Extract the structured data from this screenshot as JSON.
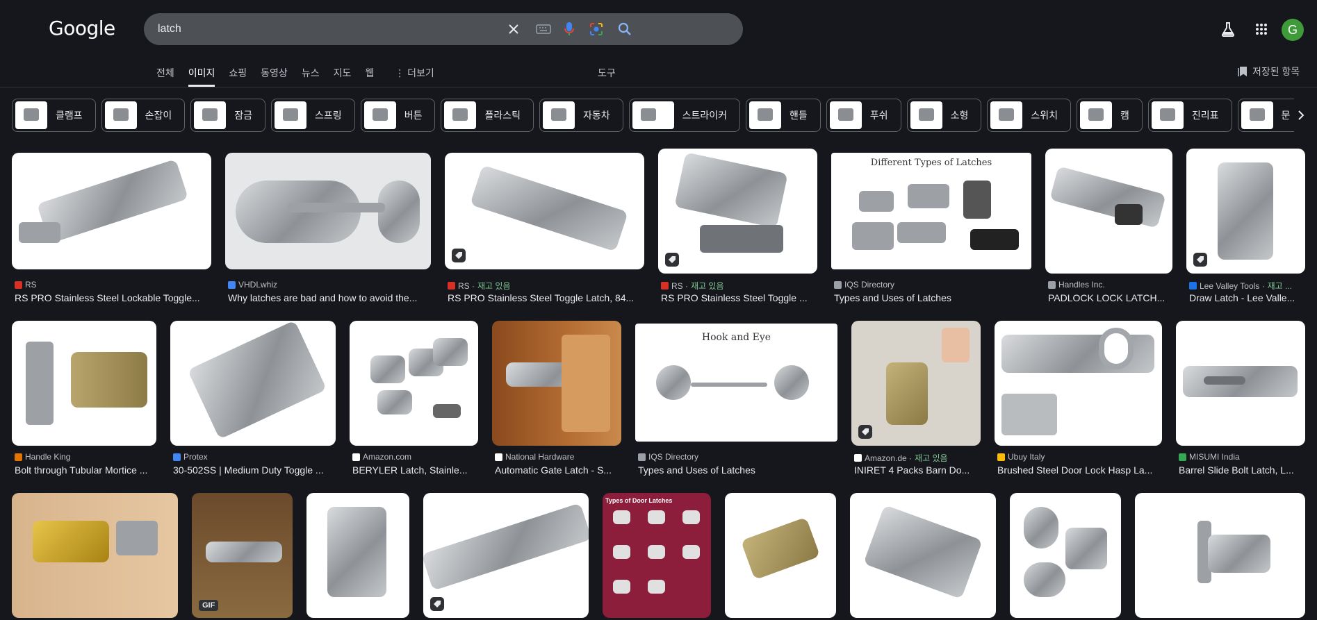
{
  "header": {
    "logo": "Google",
    "query": "latch",
    "avatar_letter": "G"
  },
  "tabs": [
    "전체",
    "이미지",
    "쇼핑",
    "동영상",
    "뉴스",
    "지도",
    "웹",
    "⋮ 더보기"
  ],
  "tools_label": "도구",
  "saved_label": "저장된 항목",
  "chips": [
    "클램프",
    "손잡이",
    "잠금",
    "스프링",
    "버튼",
    "플라스틱",
    "자동차",
    "스트라이커",
    "핸들",
    "푸쉬",
    "소형",
    "스위치",
    "캠",
    "진리표",
    "문"
  ],
  "stock_label": "재고 있음",
  "row1": [
    {
      "source": "RS",
      "title": "RS PRO Stainless Steel Lockable Toggle...",
      "fav": "#d93025"
    },
    {
      "source": "VHDLwhiz",
      "title": "Why latches are bad and how to avoid the...",
      "fav": "#4285f4"
    },
    {
      "source": "RS · ",
      "stock": "재고 있음",
      "title": "RS PRO Stainless Steel Toggle Latch, 84...",
      "fav": "#d93025"
    },
    {
      "source": "RS · ",
      "stock": "재고 있음",
      "title": "RS PRO Stainless Steel Toggle ...",
      "fav": "#d93025"
    },
    {
      "source": "IQS Directory",
      "title": "Types and Uses of Latches",
      "fav": "#9aa0a6",
      "overlay": "Different Types of Latches"
    },
    {
      "source": "Handles Inc.",
      "title": "PADLOCK LOCK LATCH...",
      "fav": "#9aa0a6"
    },
    {
      "source": "Lee Valley Tools · ",
      "stock": "재고 ...",
      "title": "Draw Latch - Lee Valle...",
      "fav": "#1a73e8"
    }
  ],
  "row2": [
    {
      "source": "Handle King",
      "title": "Bolt through Tubular Mortice ...",
      "fav": "#e37400"
    },
    {
      "source": "Protex",
      "title": "30-502SS | Medium Duty Toggle ...",
      "fav": "#4285f4"
    },
    {
      "source": "Amazon.com",
      "title": "BERYLER Latch, Stainle...",
      "fav": "#ffffff"
    },
    {
      "source": "National Hardware",
      "title": "Automatic Gate Latch - S...",
      "fav": "#ffffff"
    },
    {
      "source": "IQS Directory",
      "title": "Types and Uses of Latches",
      "fav": "#9aa0a6",
      "overlay": "Hook and Eye"
    },
    {
      "source": "Amazon.de · ",
      "stock": "재고 있음",
      "title": "INIRET 4 Packs Barn Do...",
      "fav": "#ffffff"
    },
    {
      "source": "Ubuy Italy",
      "title": "Brushed Steel Door Lock Hasp La...",
      "fav": "#fbbc04"
    },
    {
      "source": "MISUMI India",
      "title": "Barrel Slide Bolt Latch, L...",
      "fav": "#34a853"
    }
  ],
  "row3_overlays": {
    "gif": "GIF",
    "door": "Types of Door Latches"
  }
}
